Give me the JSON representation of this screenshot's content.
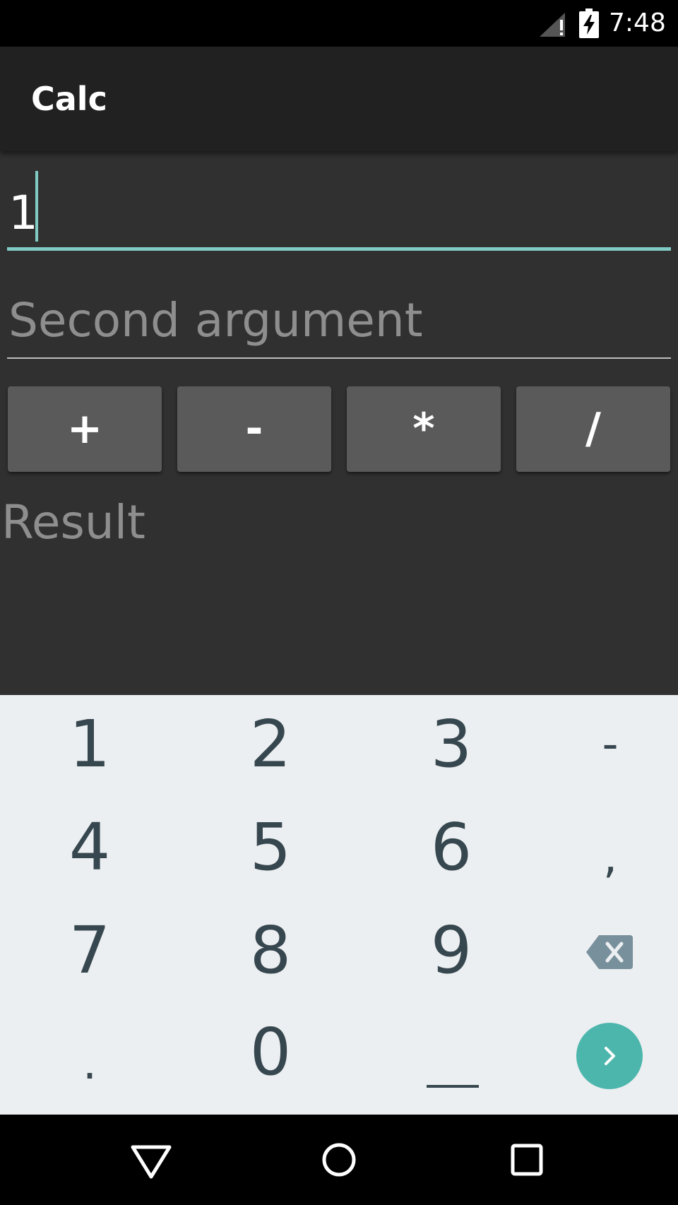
{
  "status_bar": {
    "time": "7:48",
    "icons": [
      "signal-no-service-icon",
      "battery-charging-icon"
    ]
  },
  "app_bar": {
    "title": "Calc"
  },
  "first_argument": {
    "value": "1"
  },
  "second_argument": {
    "placeholder": "Second argument",
    "value": ""
  },
  "operators": {
    "plus": "+",
    "minus": "-",
    "multiply": "*",
    "divide": "/"
  },
  "result": {
    "text": "Result"
  },
  "keyboard": {
    "rows": [
      [
        "1",
        "2",
        "3",
        "-"
      ],
      [
        "4",
        "5",
        "6",
        ","
      ],
      [
        "7",
        "8",
        "9"
      ],
      [
        ".",
        "0"
      ]
    ],
    "backspace_icon": "backspace-icon",
    "enter_icon": "chevron-right-icon",
    "space_icon": "space-icon",
    "colors": {
      "background": "#eceff1",
      "key_text": "#37474f",
      "enter": "#4db6ac"
    }
  },
  "nav_bar": {
    "icons": [
      "back-icon",
      "home-icon",
      "recents-icon"
    ]
  },
  "colors": {
    "accent": "#80cbc4",
    "app_bar": "#212121",
    "background": "#303030",
    "button": "#5a5a5a"
  }
}
